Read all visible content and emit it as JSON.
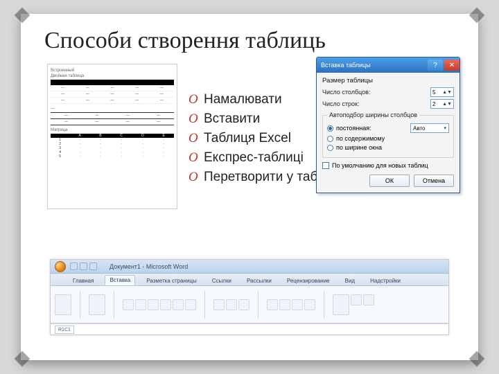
{
  "title": "Способи створення таблиць",
  "bullets": {
    "items": [
      {
        "marker": "O",
        "text": "Намалювати"
      },
      {
        "marker": "O",
        "text": "Вставити"
      },
      {
        "marker": "O",
        "text": "Таблиця Excel"
      },
      {
        "marker": "O",
        "text": "Експрес-таблиці"
      },
      {
        "marker": "O",
        "text": "Перетворити у таблицю"
      }
    ]
  },
  "dialog": {
    "title": "Вставка таблицы",
    "group_title": "Размер таблицы",
    "cols_label": "Число столбцов:",
    "cols_value": "5",
    "rows_label": "Число строк:",
    "rows_value": "2",
    "autofit_legend": "Автоподбор ширины столбцов",
    "opt_fixed": "постоянная:",
    "opt_fixed_value": "Авто",
    "opt_content": "по содержимому",
    "opt_window": "по ширине окна",
    "remember": "По умолчанию для новых таблиц",
    "ok": "ОК",
    "cancel": "Отмена",
    "help_glyph": "?",
    "close_glyph": "✕"
  },
  "gallery": {
    "sec1": "Встроенный",
    "sec2": "Двойная таблица",
    "matrix_title": "Матрица"
  },
  "ribbon": {
    "doc_title": "Документ1 - Microsoft Word",
    "tabs": [
      "Главная",
      "Вставка",
      "Разметка страницы",
      "Ссылки",
      "Рассылки",
      "Рецензирование",
      "Вид",
      "Надстройки"
    ],
    "active_tab_index": 1,
    "cell_ref": "R1C1"
  }
}
